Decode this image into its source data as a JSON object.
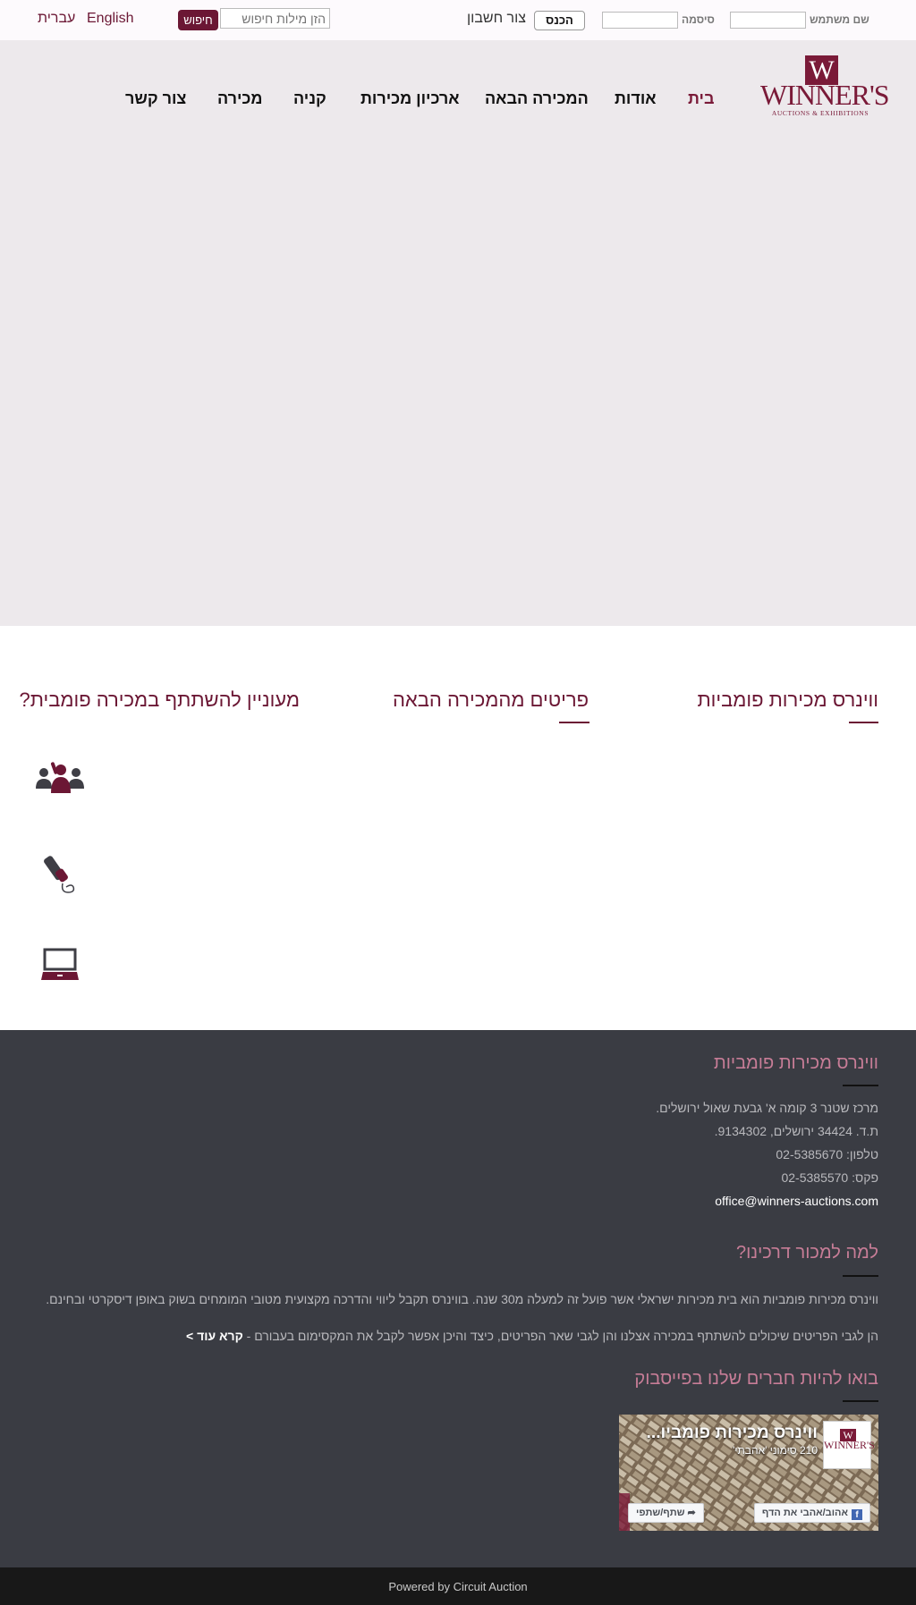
{
  "topbar": {
    "lang_hebrew": "עברית",
    "lang_english": "English",
    "search_button": "חיפוש",
    "search_placeholder": "הזן מילות חיפוש",
    "signup_link": "צור חשבון",
    "login_button": "הכנס",
    "password_label": "סיסמה",
    "username_label": "שם משתמש"
  },
  "logo": {
    "letter": "W",
    "name": "WINNER'S",
    "tagline": "AUCTIONS & EXHIBITIONS"
  },
  "nav": {
    "items": [
      {
        "label": "בית",
        "active": true
      },
      {
        "label": "אודות",
        "active": false
      },
      {
        "label": "המכירה הבאה",
        "active": false
      },
      {
        "label": "ארכיון מכירות",
        "active": false
      },
      {
        "label": "קניה",
        "active": false
      },
      {
        "label": "מכירה",
        "active": false
      },
      {
        "label": "צור קשר",
        "active": false
      }
    ]
  },
  "sections": {
    "col1_title": "ווינרס מכירות פומביות",
    "col2_title": "פריטים מהמכירה הבאה",
    "col3_title": "מעוניין להשתתף במכירה פומבית?",
    "icons": [
      "audience-icon",
      "phone-icon",
      "laptop-icon"
    ]
  },
  "footer": {
    "contact_title": "ווינרס מכירות פומביות",
    "address": "מרכז שטנר 3 קומה א' גבעת שאול ירושלים.",
    "po_box": "ת.ד. 34424 ירושלים, 9134302.",
    "phone": "טלפון: 02-5385670",
    "fax": "פקס: 02-5385570",
    "email": "office@winners-auctions.com",
    "why_title": "למה למכור דרכינו?",
    "why_text": "ווינרס מכירות פומביות הוא בית מכירות ישראלי אשר פועל זה למעלה מ30 שנה. בווינרס תקבל ליווי והדרכה מקצועית מטובי המומחים בשוק באופן דיסקרטי ובחינם.",
    "why_text2": "הן לגבי הפריטים שיכולים להשתתף במכירה אצלנו והן לגבי שאר הפריטים, כיצד והיכן אפשר לקבל את המקסימום בעבורם -",
    "read_more": "קרא עוד >",
    "fb_title": "בואו להיות חברים שלנו בפייסבוק",
    "fb_page_name": "ווינרס מכירות פומביו...",
    "fb_likes": "210 סימוני 'אהבתי'",
    "fb_like_button": "אהוב/אהבי את הדף",
    "fb_share_button": "שתף/שתפי"
  },
  "bottom": {
    "powered_by": "Powered by Circuit Auction"
  },
  "colors": {
    "brand": "#6b1734",
    "footer_bg": "#3a3c43",
    "hero_bg": "#ede9ec"
  }
}
